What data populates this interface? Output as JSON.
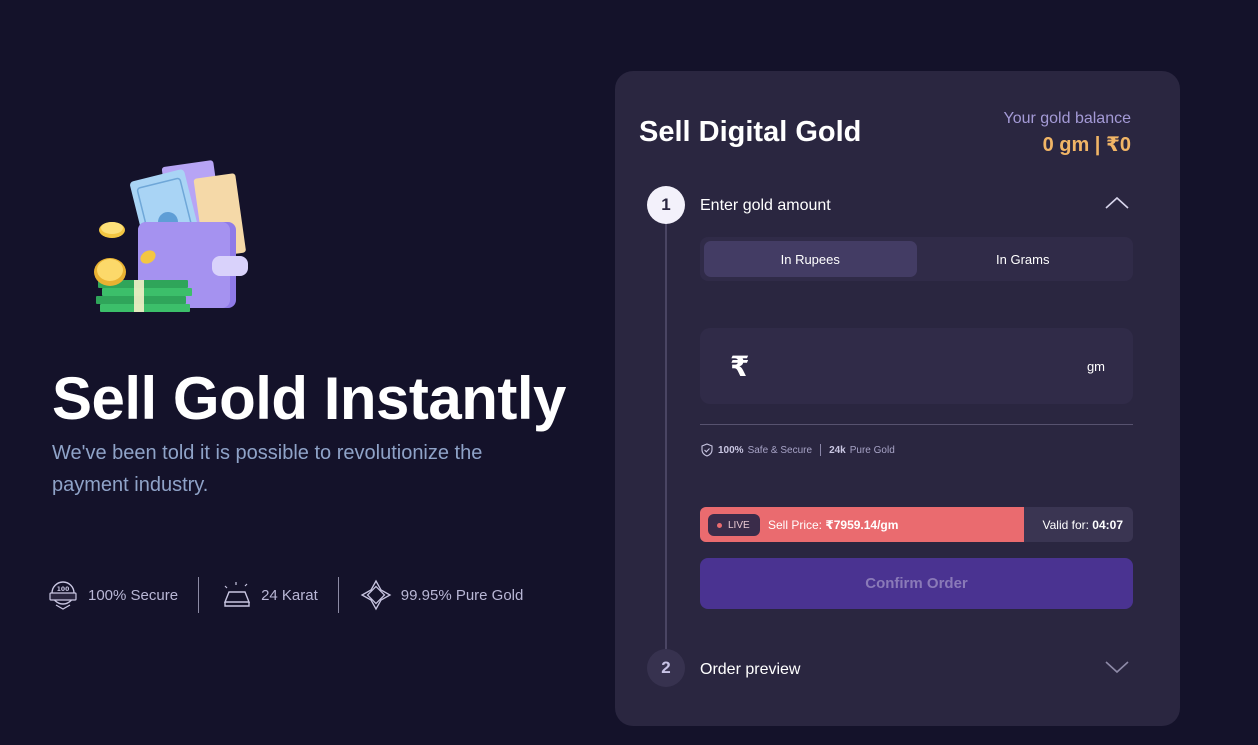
{
  "hero": {
    "title": "Sell Gold Instantly",
    "subtitle": "We've been told it is possible to revolutionize the payment industry.",
    "illustration_icon": "wallet-cash-coins-illustration",
    "features": [
      {
        "label": "100% Secure",
        "icon": "secured-badge-icon"
      },
      {
        "label": "24 Karat",
        "icon": "gold-bar-icon"
      },
      {
        "label": "99.95% Pure Gold",
        "icon": "purity-flower-icon"
      }
    ]
  },
  "card": {
    "title": "Sell Digital Gold",
    "balance_label": "Your gold balance",
    "balance_value": "0 gm | ₹0",
    "step1": {
      "number": "1",
      "label": "Enter gold amount",
      "chevron": "chevron-up-icon"
    },
    "step2": {
      "number": "2",
      "label": "Order preview",
      "chevron": "chevron-down-icon"
    },
    "toggle": {
      "rupees": "In Rupees",
      "grams": "In Grams",
      "active": "rupees"
    },
    "amount": {
      "currency_symbol": "₹",
      "value": "",
      "unit": "gm"
    },
    "secure_note": {
      "part1_bold": "100%",
      "part1": "Safe & Secure",
      "part2_bold": "24k",
      "part2": "Pure Gold",
      "icon": "shield-check-icon"
    },
    "price": {
      "live_label": "LIVE",
      "sell_label": "Sell Price:",
      "sell_value": "₹7959.14/gm",
      "valid_label": "Valid for:",
      "valid_value": "04:07",
      "timer_progress": 0.749
    },
    "confirm_label": "Confirm Order"
  },
  "colors": {
    "background": "#14122a",
    "card": "#2a2640",
    "accent_gold": "#f1b566",
    "live_red": "#ea6b6f",
    "button_purple": "#4a3391"
  }
}
